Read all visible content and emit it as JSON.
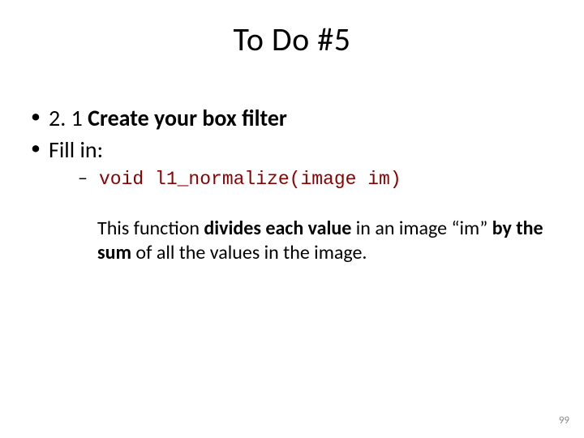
{
  "title": "To Do #5",
  "bullets": {
    "b1_pre": "2. 1 ",
    "b1_bold": "Create your box filter",
    "b2": "Fill in:"
  },
  "sub": {
    "code": "void l1_normalize(image im)"
  },
  "para": {
    "t1": "This function ",
    "t2_bold": "divides each value",
    "t3": " in an image “im” ",
    "t4_bold": "by the sum",
    "t5": " of all the values in the image."
  },
  "page_number": "99"
}
